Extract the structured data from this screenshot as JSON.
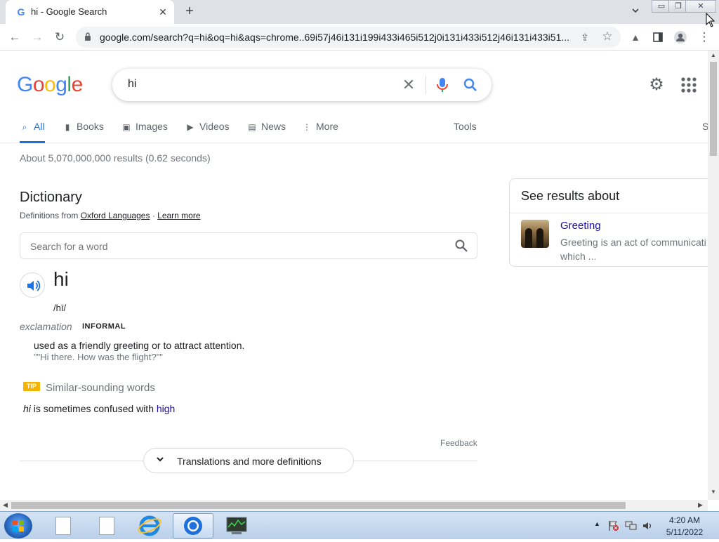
{
  "browser": {
    "tab_title": "hi - Google Search",
    "tab_favicon": "G",
    "new_tab_label": "+",
    "url": "google.com/search?q=hi&oq=hi&aqs=chrome..69i57j46i131i199i433i465i512j0i131i433i512j46i131i433i51..."
  },
  "google": {
    "logo_text": "Google",
    "query": "hi",
    "tabs": [
      {
        "label": "All",
        "icon": "search-icon"
      },
      {
        "label": "Books",
        "icon": "book-icon"
      },
      {
        "label": "Images",
        "icon": "image-icon"
      },
      {
        "label": "Videos",
        "icon": "video-icon"
      },
      {
        "label": "News",
        "icon": "news-icon"
      },
      {
        "label": "More",
        "icon": "more-vert-icon"
      }
    ],
    "tools_label": "Tools",
    "safe_label": "S",
    "stats": "About 5,070,000,000 results (0.62 seconds)"
  },
  "dictionary": {
    "title": "Dictionary",
    "source_prefix": "Definitions from",
    "source_link": "Oxford Languages",
    "separator": "·",
    "learn_more": "Learn more",
    "search_placeholder": "Search for a word",
    "word": "hi",
    "phonetic": "/hī/",
    "part_of_speech": "exclamation",
    "register": "INFORMAL",
    "definition": "used as a friendly greeting or to attract attention.",
    "example": "\"\"Hi there. How was the flight?\"\"",
    "tip_badge": "TIP",
    "similar_heading": "Similar-sounding words",
    "confused_word": "hi",
    "confused_text": " is sometimes confused with ",
    "confused_link": "high",
    "feedback": "Feedback",
    "more_button": "Translations and more definitions"
  },
  "knowledge_panel": {
    "heading": "See results about",
    "entity_name": "Greeting",
    "entity_desc_1": "Greeting is an act of communicati",
    "entity_desc_2": "which ..."
  },
  "taskbar": {
    "time": "4:20 AM",
    "date": "5/11/2022"
  },
  "colors": {
    "google_blue": "#4285f4",
    "google_red": "#ea4335",
    "google_yellow": "#fbbc05",
    "google_green": "#34a853",
    "link": "#1a0dab",
    "active_tab": "#1a73e8"
  }
}
